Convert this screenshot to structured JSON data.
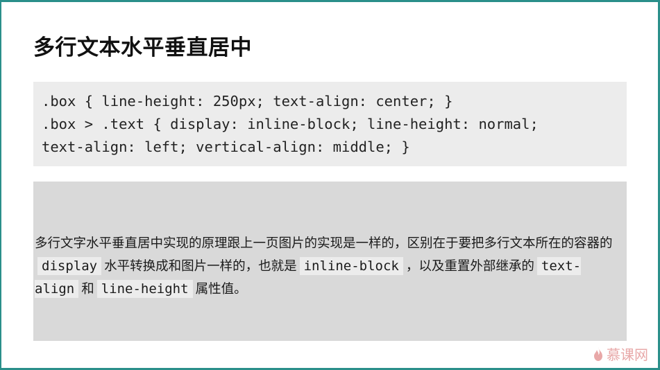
{
  "slide": {
    "title": "多行文本水平垂直居中",
    "code_lines": [
      ".box { line-height: 250px; text-align: center; }",
      ".box > .text { display: inline-block; line-height: normal;",
      "text-align: left; vertical-align: middle; }"
    ],
    "description": {
      "part1": "多行文字水平垂直居中实现的原理跟上一页图片的实现是一样的，区别在于要把多行文本所在的容器的",
      "code1": "display",
      "part2": "水平转换成和图片一样的，也就是",
      "code2": "inline-block",
      "part3": "，以及重置外部继承的",
      "code3": "text-align",
      "part4": "和",
      "code4": "line-height",
      "part5": "属性值。"
    },
    "logo_text": "慕课网",
    "logo_icon": "flame-icon",
    "colors": {
      "frame": "#2a8f8a",
      "code_bg": "#ececec",
      "desc_bg": "#d9d9d9",
      "logo": "#e8a8a8"
    }
  }
}
